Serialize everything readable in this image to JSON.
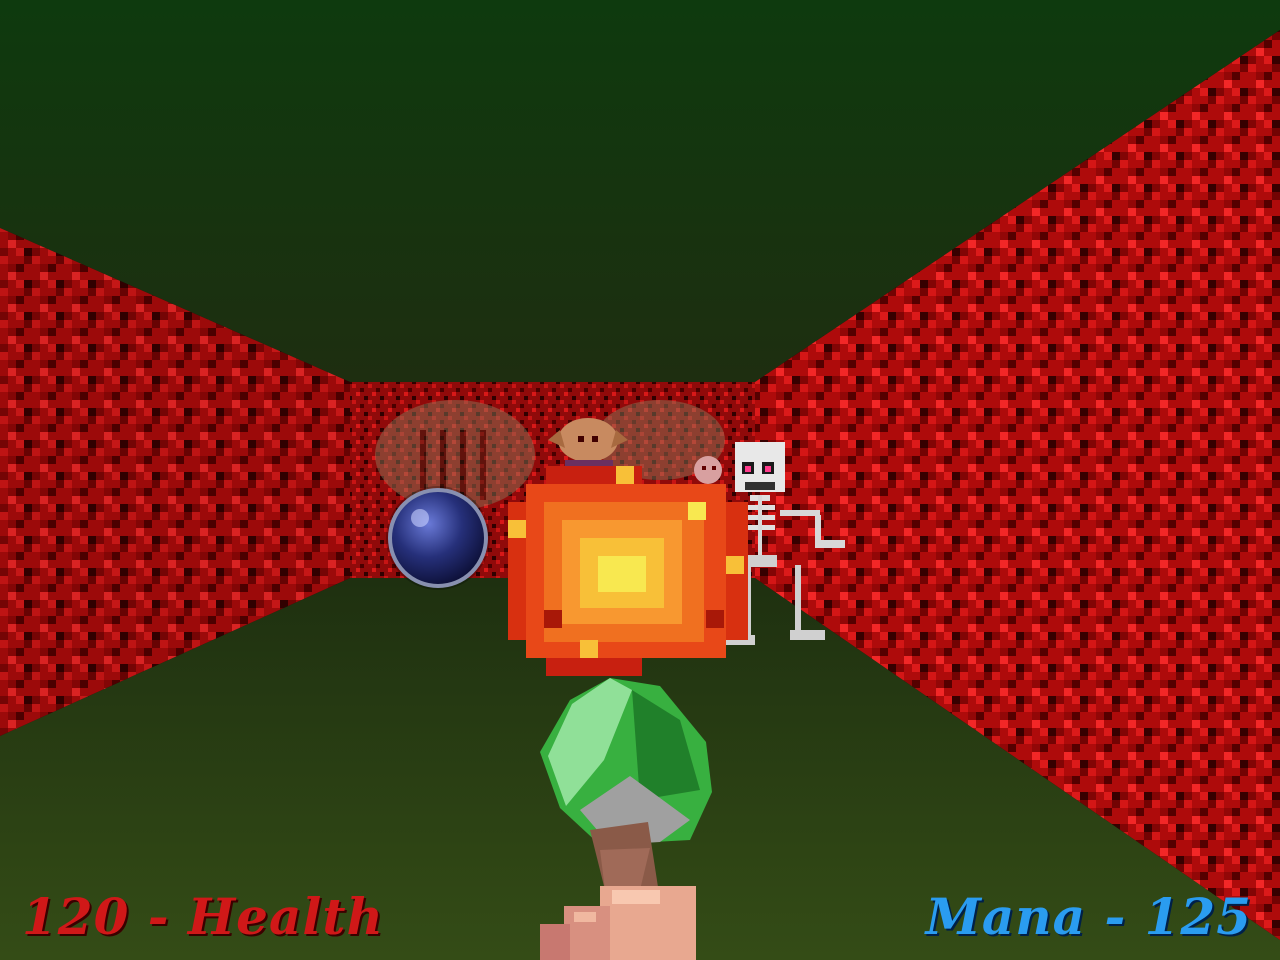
{
  "hud": {
    "health_value": "120",
    "health_label": "Health",
    "health_text": "120 - Health",
    "mana_value": "125",
    "mana_label": "Mana",
    "mana_text": "Mana - 125",
    "health_color": "#d01818",
    "mana_color": "#2a9cf0"
  },
  "scene": {
    "ceiling_color_top": "#0f3a0f",
    "ceiling_color_bottom": "#2c4a18",
    "floor_color": "#273d12",
    "wall_color": "#c01010",
    "wall_dark_color": "#4a0000",
    "entities": [
      "skeleton",
      "goblin",
      "imp",
      "blue-orb",
      "fireball",
      "magic-staff",
      "hand"
    ]
  }
}
